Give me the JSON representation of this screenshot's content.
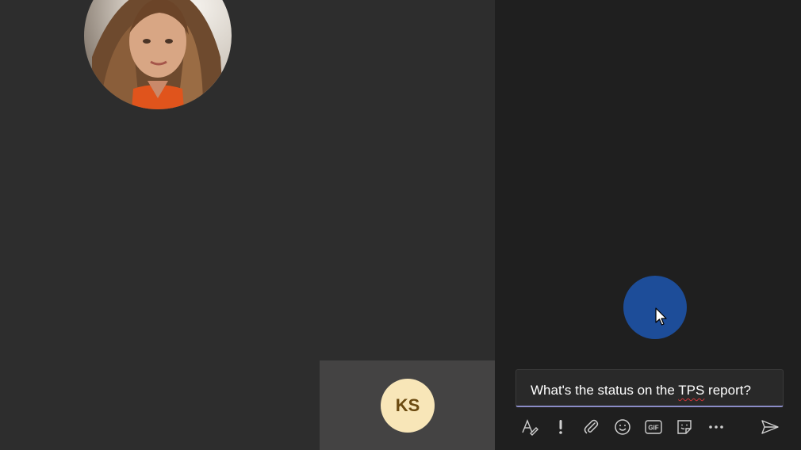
{
  "stage": {
    "self_avatar_initials": "KS"
  },
  "chat": {
    "compose": {
      "text_before": "What's the status on the ",
      "text_flagged": "TPS",
      "text_after": " report?"
    },
    "toolbar": {
      "icons": [
        "format-icon",
        "important-icon",
        "attach-icon",
        "emoji-icon",
        "gif-icon",
        "sticker-icon",
        "more-options-icon",
        "send-icon"
      ],
      "gif_label": "GIF"
    }
  },
  "colors": {
    "stage_bg": "#2d2d2d",
    "panel_bg": "#1f1f1f",
    "avatar_bg": "#f8e6b8",
    "avatar_text": "#6b4a10",
    "cursor_halo": "#1d4d99",
    "compose_underline": "#8b8cc7",
    "spellcheck": "#d13438"
  }
}
